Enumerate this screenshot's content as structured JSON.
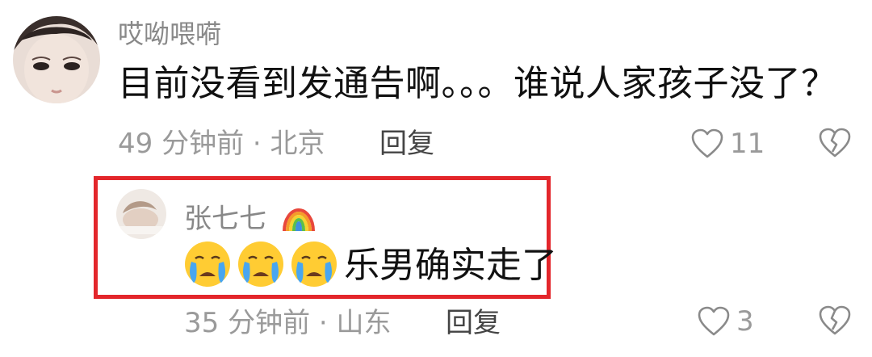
{
  "comment": {
    "username": "哎呦喂嗬",
    "text": "目前没看到发通告啊。。。谁说人家孩子没了？",
    "time_location": "49 分钟前 · 北京",
    "reply_label": "回复",
    "likes": "11"
  },
  "reply": {
    "username": "张七七",
    "username_emoji": "rainbow-emoji",
    "emojis": [
      "crying-face-emoji",
      "crying-face-emoji",
      "crying-face-emoji"
    ],
    "text": "乐男确实走了",
    "time_location": "35 分钟前 · 山东",
    "reply_label": "回复",
    "likes": "3"
  },
  "colors": {
    "highlight_border": "#e3262b",
    "secondary_text": "#9a9a9a",
    "primary_text": "#111111"
  }
}
